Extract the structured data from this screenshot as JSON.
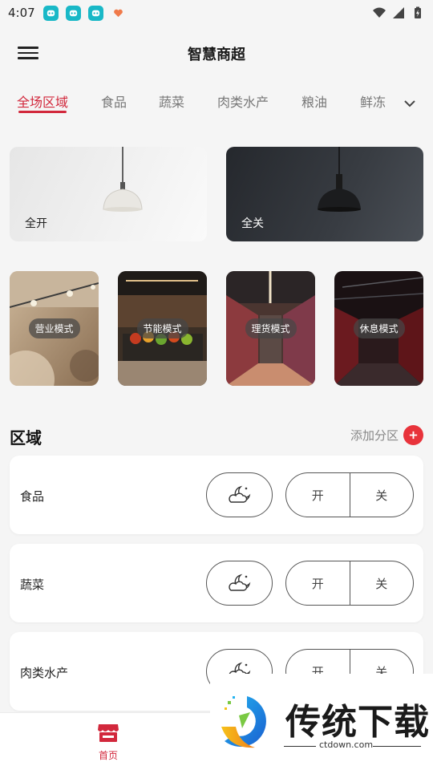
{
  "status_bar": {
    "time": "4:07"
  },
  "header": {
    "title": "智慧商超"
  },
  "tabs": [
    {
      "label": "全场区域",
      "active": true
    },
    {
      "label": "食品"
    },
    {
      "label": "蔬菜"
    },
    {
      "label": "肉类水产"
    },
    {
      "label": "粮油"
    },
    {
      "label": "鲜冻"
    }
  ],
  "master": {
    "all_on_label": "全开",
    "all_off_label": "全关"
  },
  "modes": [
    {
      "label": "营业模式"
    },
    {
      "label": "节能模式"
    },
    {
      "label": "理货模式"
    },
    {
      "label": "休息模式"
    }
  ],
  "zones_section": {
    "title": "区域",
    "add_label": "添加分区"
  },
  "zones": [
    {
      "name": "食品",
      "on_label": "开",
      "off_label": "关"
    },
    {
      "name": "蔬菜",
      "on_label": "开",
      "off_label": "关"
    },
    {
      "name": "肉类水产",
      "on_label": "开",
      "off_label": "关"
    }
  ],
  "bottom_nav": {
    "home_label": "首页"
  },
  "watermark": {
    "brand": "传统下载",
    "url": "ctdown.com"
  },
  "colors": {
    "accent": "#d2283c",
    "add_button": "#e8333b",
    "status_icon": "#19b8c7"
  }
}
